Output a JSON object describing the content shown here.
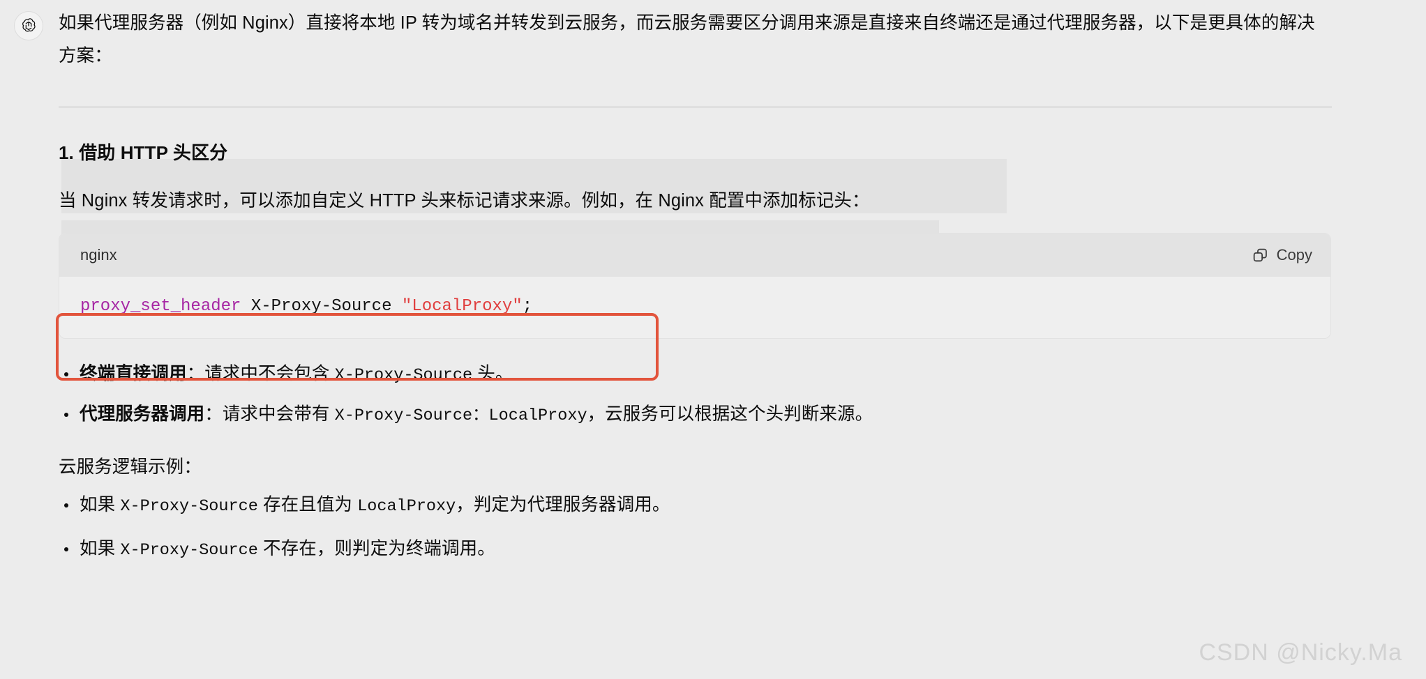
{
  "theme": {
    "page_background": "#ececec",
    "text_color": "#0d0d0d",
    "code_background": "#efefef",
    "code_header_background": "#e3e3e3",
    "annotation_box_color": "#e2543c",
    "keyword_color": "#a626a4",
    "string_color": "#e03e3e",
    "divider_color": "#b9b9b9",
    "watermark_color": "#d2d2d2"
  },
  "message": {
    "avatar_icon": "openai-logo-icon",
    "intro_paragraph": "如果代理服务器（例如 Nginx）直接将本地 IP 转为域名并转发到云服务，而云服务需要区分调用来源是直接来自终端还是通过代理服务器，以下是更具体的解决方案："
  },
  "section": {
    "heading": "1. 借助 HTTP 头区分",
    "description": "当 Nginx 转发请求时，可以添加自定义 HTTP 头来标记请求来源。例如，在 Nginx 配置中添加标记头："
  },
  "code_block": {
    "language_label": "nginx",
    "copy_button_label": "Copy",
    "copy_icon": "copy-icon",
    "tokens": {
      "keyword": "proxy_set_header",
      "space1": " ",
      "header_name": "X-Proxy-Source",
      "space2": " ",
      "string": "\"LocalProxy\"",
      "terminator": ";"
    },
    "full_line": "proxy_set_header X-Proxy-Source \"LocalProxy\";",
    "annotated": true
  },
  "behavior_list": [
    {
      "label": "终端直接调用",
      "separator": "：",
      "text_before_code": "请求中不会包含 ",
      "code": "X-Proxy-Source",
      "text_after_code": " 头。"
    },
    {
      "label": "代理服务器调用",
      "separator": "：",
      "text_before_code": "请求中会带有 ",
      "code": "X-Proxy-Source：LocalProxy",
      "text_after_code": "，云服务可以根据这个头判断来源。"
    }
  ],
  "logic_example": {
    "title": "云服务逻辑示例：",
    "items": [
      {
        "prefix": "如果 ",
        "code1": "X-Proxy-Source",
        "middle": " 存在且值为 ",
        "code2": "LocalProxy",
        "suffix": "，判定为代理服务器调用。"
      },
      {
        "prefix": "如果 ",
        "code1": "X-Proxy-Source",
        "middle": " 不存在，则判定为终端调用。",
        "code2": "",
        "suffix": ""
      }
    ]
  },
  "watermark": {
    "text": "CSDN @Nicky.Ma"
  }
}
